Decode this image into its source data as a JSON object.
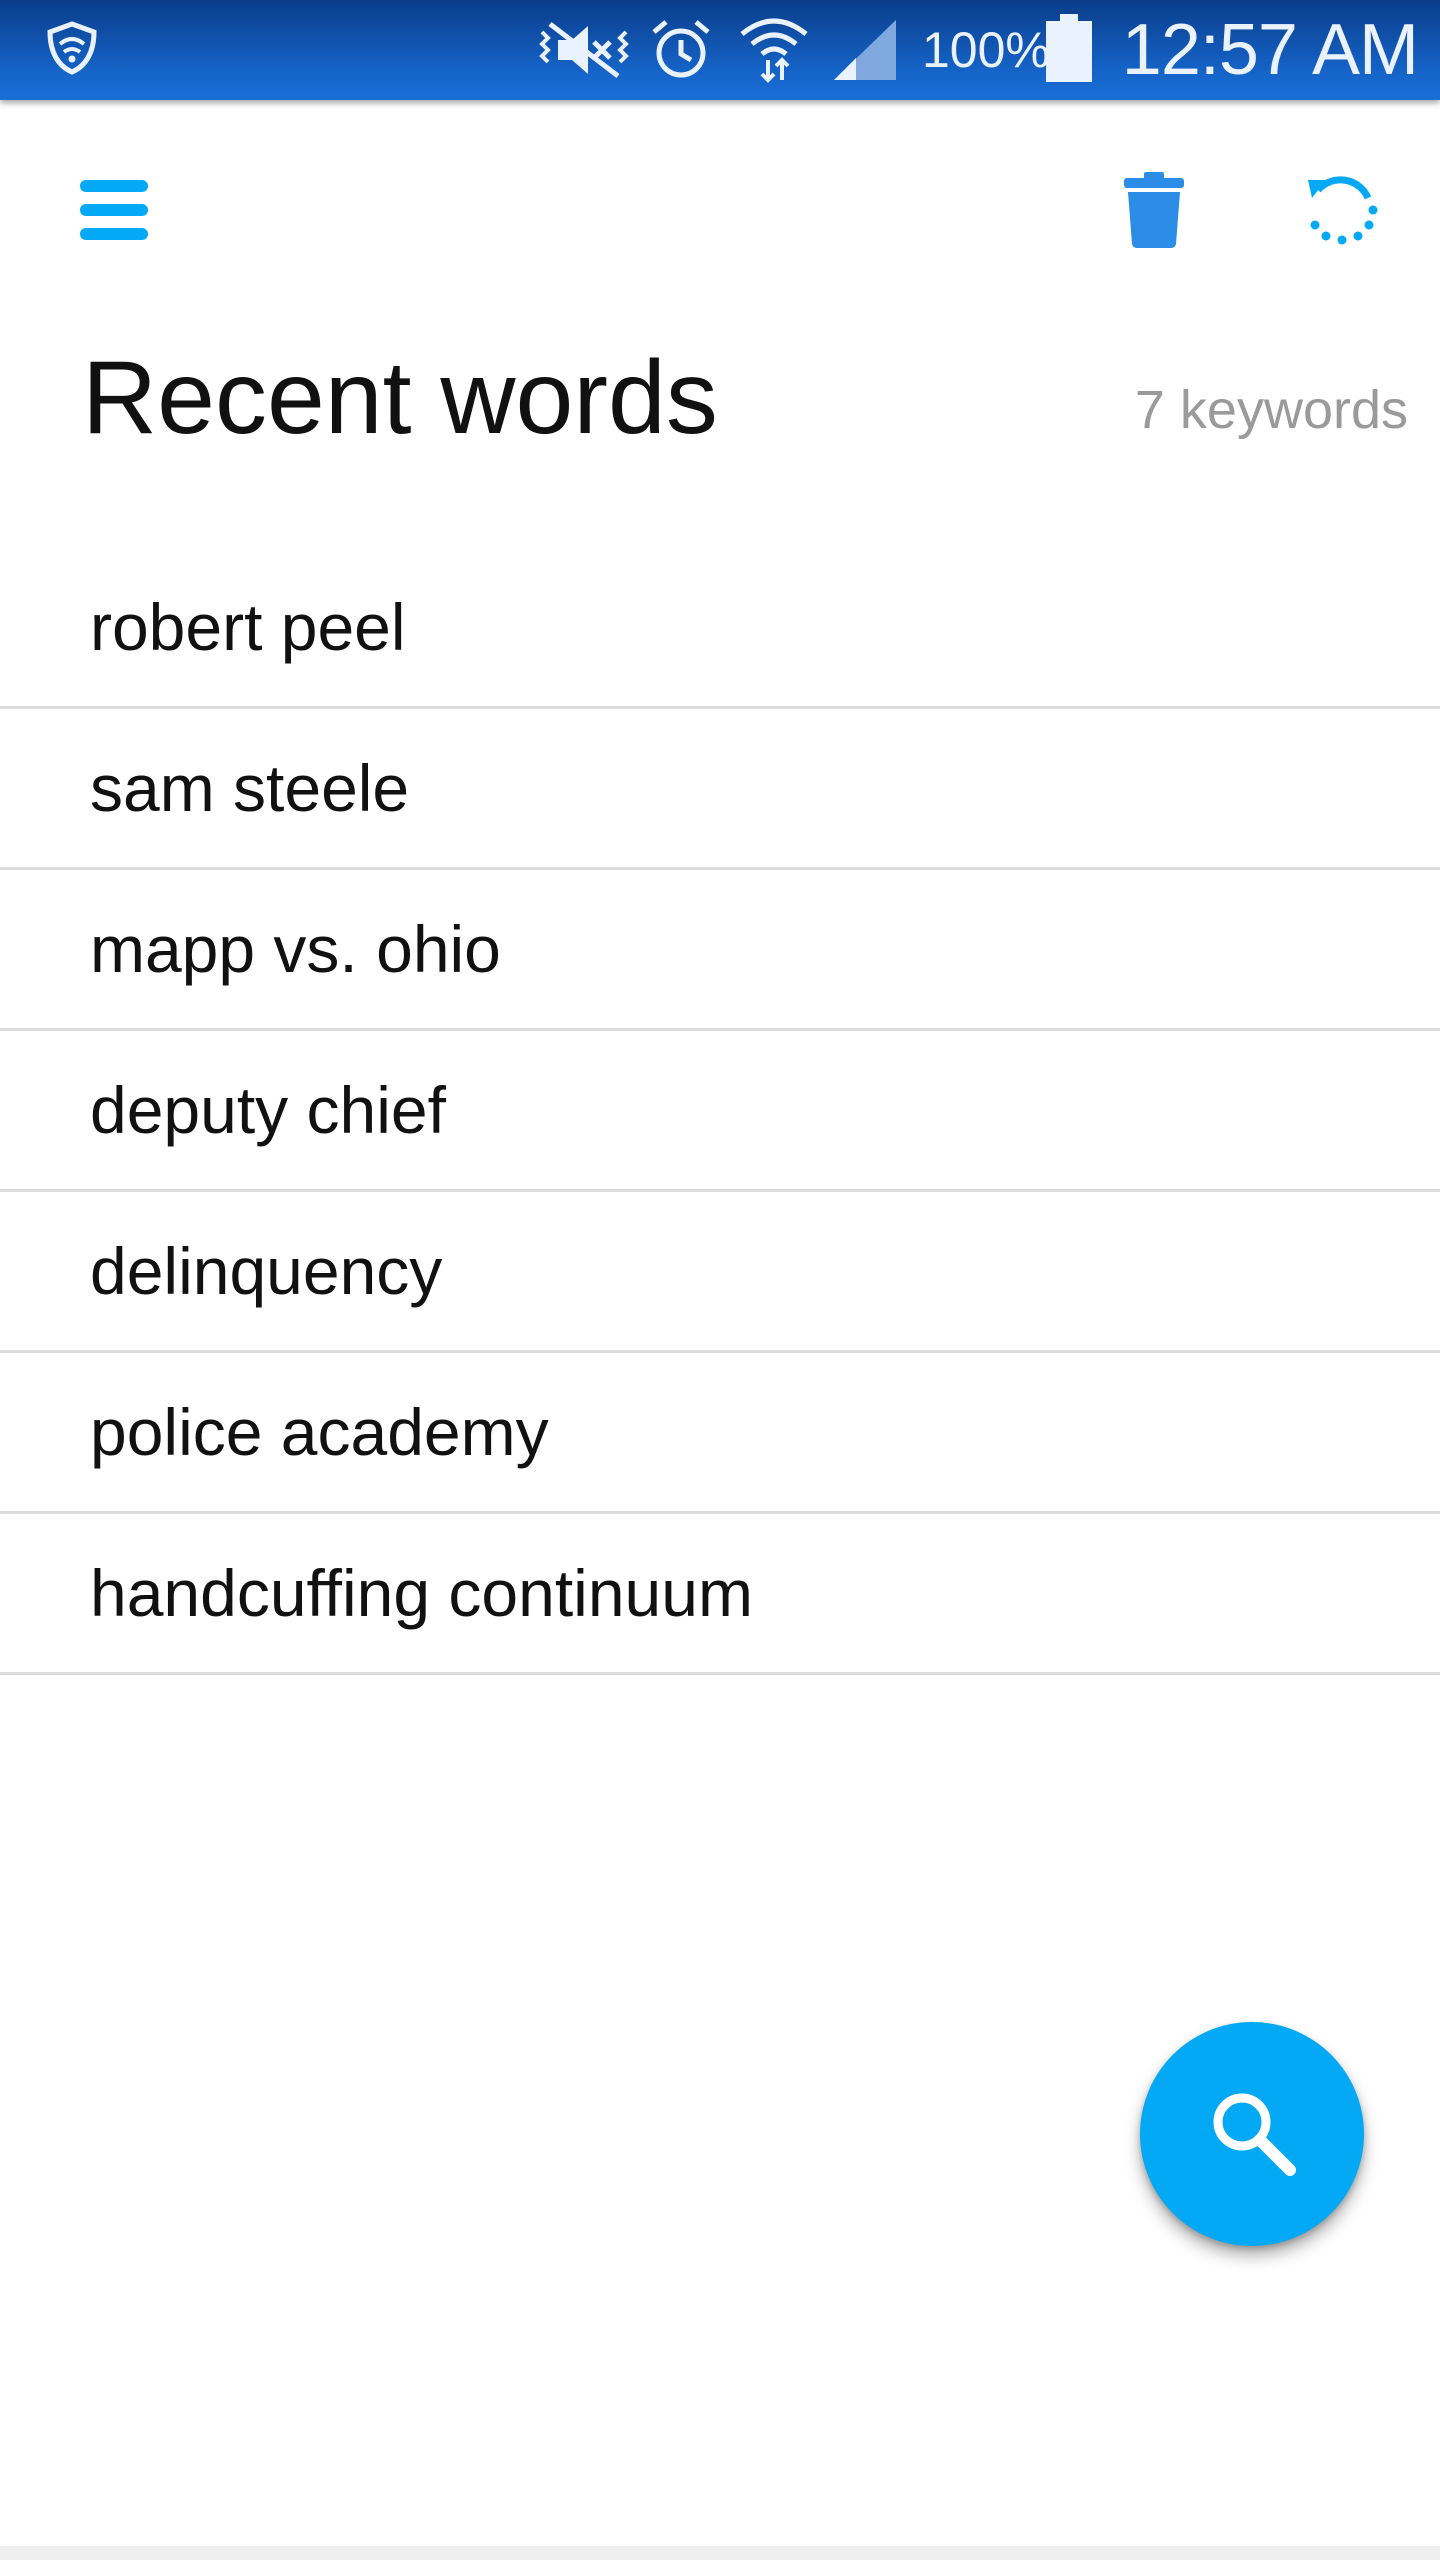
{
  "status_bar": {
    "battery_percent": "100%",
    "time": "12:57 AM",
    "icons": [
      "shield-icon",
      "vibrate-mute-icon",
      "alarm-icon",
      "wifi-icon",
      "signal-icon",
      "battery-icon"
    ]
  },
  "toolbar": {
    "menu_icon": "menu-icon",
    "delete_icon": "trash-icon",
    "refresh_icon": "refresh-icon"
  },
  "header": {
    "title": "Recent words",
    "count": "7 keywords"
  },
  "words": [
    {
      "label": "robert peel"
    },
    {
      "label": "sam steele"
    },
    {
      "label": "mapp vs. ohio"
    },
    {
      "label": "deputy chief"
    },
    {
      "label": "delinquency"
    },
    {
      "label": "police academy"
    },
    {
      "label": "handcuffing continuum"
    }
  ],
  "fab": {
    "icon": "search-icon"
  },
  "colors": {
    "accent": "#03a9f4",
    "toolbar_icon": "#1e8fe6",
    "status_bar": "#1563c7",
    "divider": "#dcdcdc",
    "secondary_text": "#9a9a9a"
  }
}
